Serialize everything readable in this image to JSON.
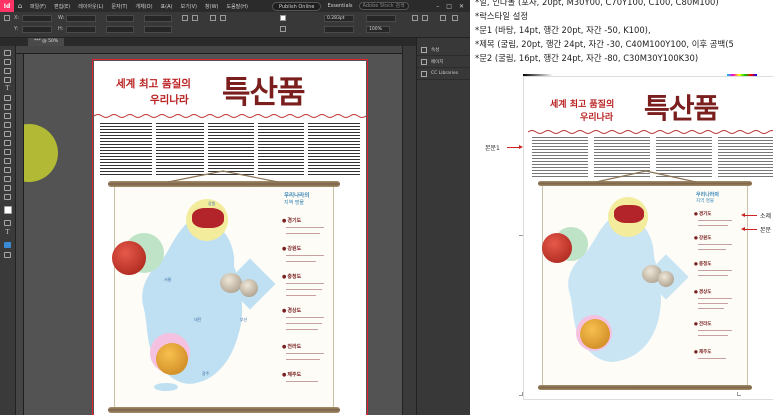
{
  "app": {
    "logo": "Id",
    "menu": [
      "파일(F)",
      "편집(E)",
      "레이아웃(L)",
      "문자(T)",
      "개체(O)",
      "표(A)",
      "보기(V)",
      "창(W)",
      "도움말(H)"
    ],
    "publish_online": "Publish Online",
    "workspace": "Essentials",
    "search_placeholder": "Adobe Stock 검색",
    "ctrl": {
      "stroke_weight": "0.283pt",
      "opacity": "100%"
    },
    "doc_tab": "*** @ 50%",
    "panel_items": [
      "속성",
      "페이지",
      "CC Libraries"
    ]
  },
  "layout": {
    "title_line1": "세계 최고 품질의",
    "title_line2": "우리나라",
    "brush_title": "특산품",
    "region_title": "우리나라의",
    "region_sub": "지역 명물",
    "regions": [
      "경기도",
      "강원도",
      "충청도",
      "경상도",
      "전라도",
      "제주도"
    ],
    "map_labels": [
      "서울",
      "강원",
      "대전",
      "부산",
      "광주"
    ]
  },
  "right_doc": {
    "lines": [
      "*일, 인다볼 (포자, 20pt, M30Y00, C70Y100, C100, C80M100)",
      "*락스타일 설정",
      "*문1 (바탕, 14pt, 행간 20pt, 자간 -50, K100),",
      "*제목 (굴림, 20pt, 행간 24pt, 자간 -30, C40M100Y100, 이후 공백(5",
      "*문2 (굴림, 16pt, 행간 24pt, 자간 -80, C30M30Y100K30)"
    ],
    "label_body1": "본문1",
    "label_subtitle": "소제",
    "label_body2": "본문",
    "colors": {
      "red": "#c22222",
      "accent": "#b22222"
    }
  }
}
